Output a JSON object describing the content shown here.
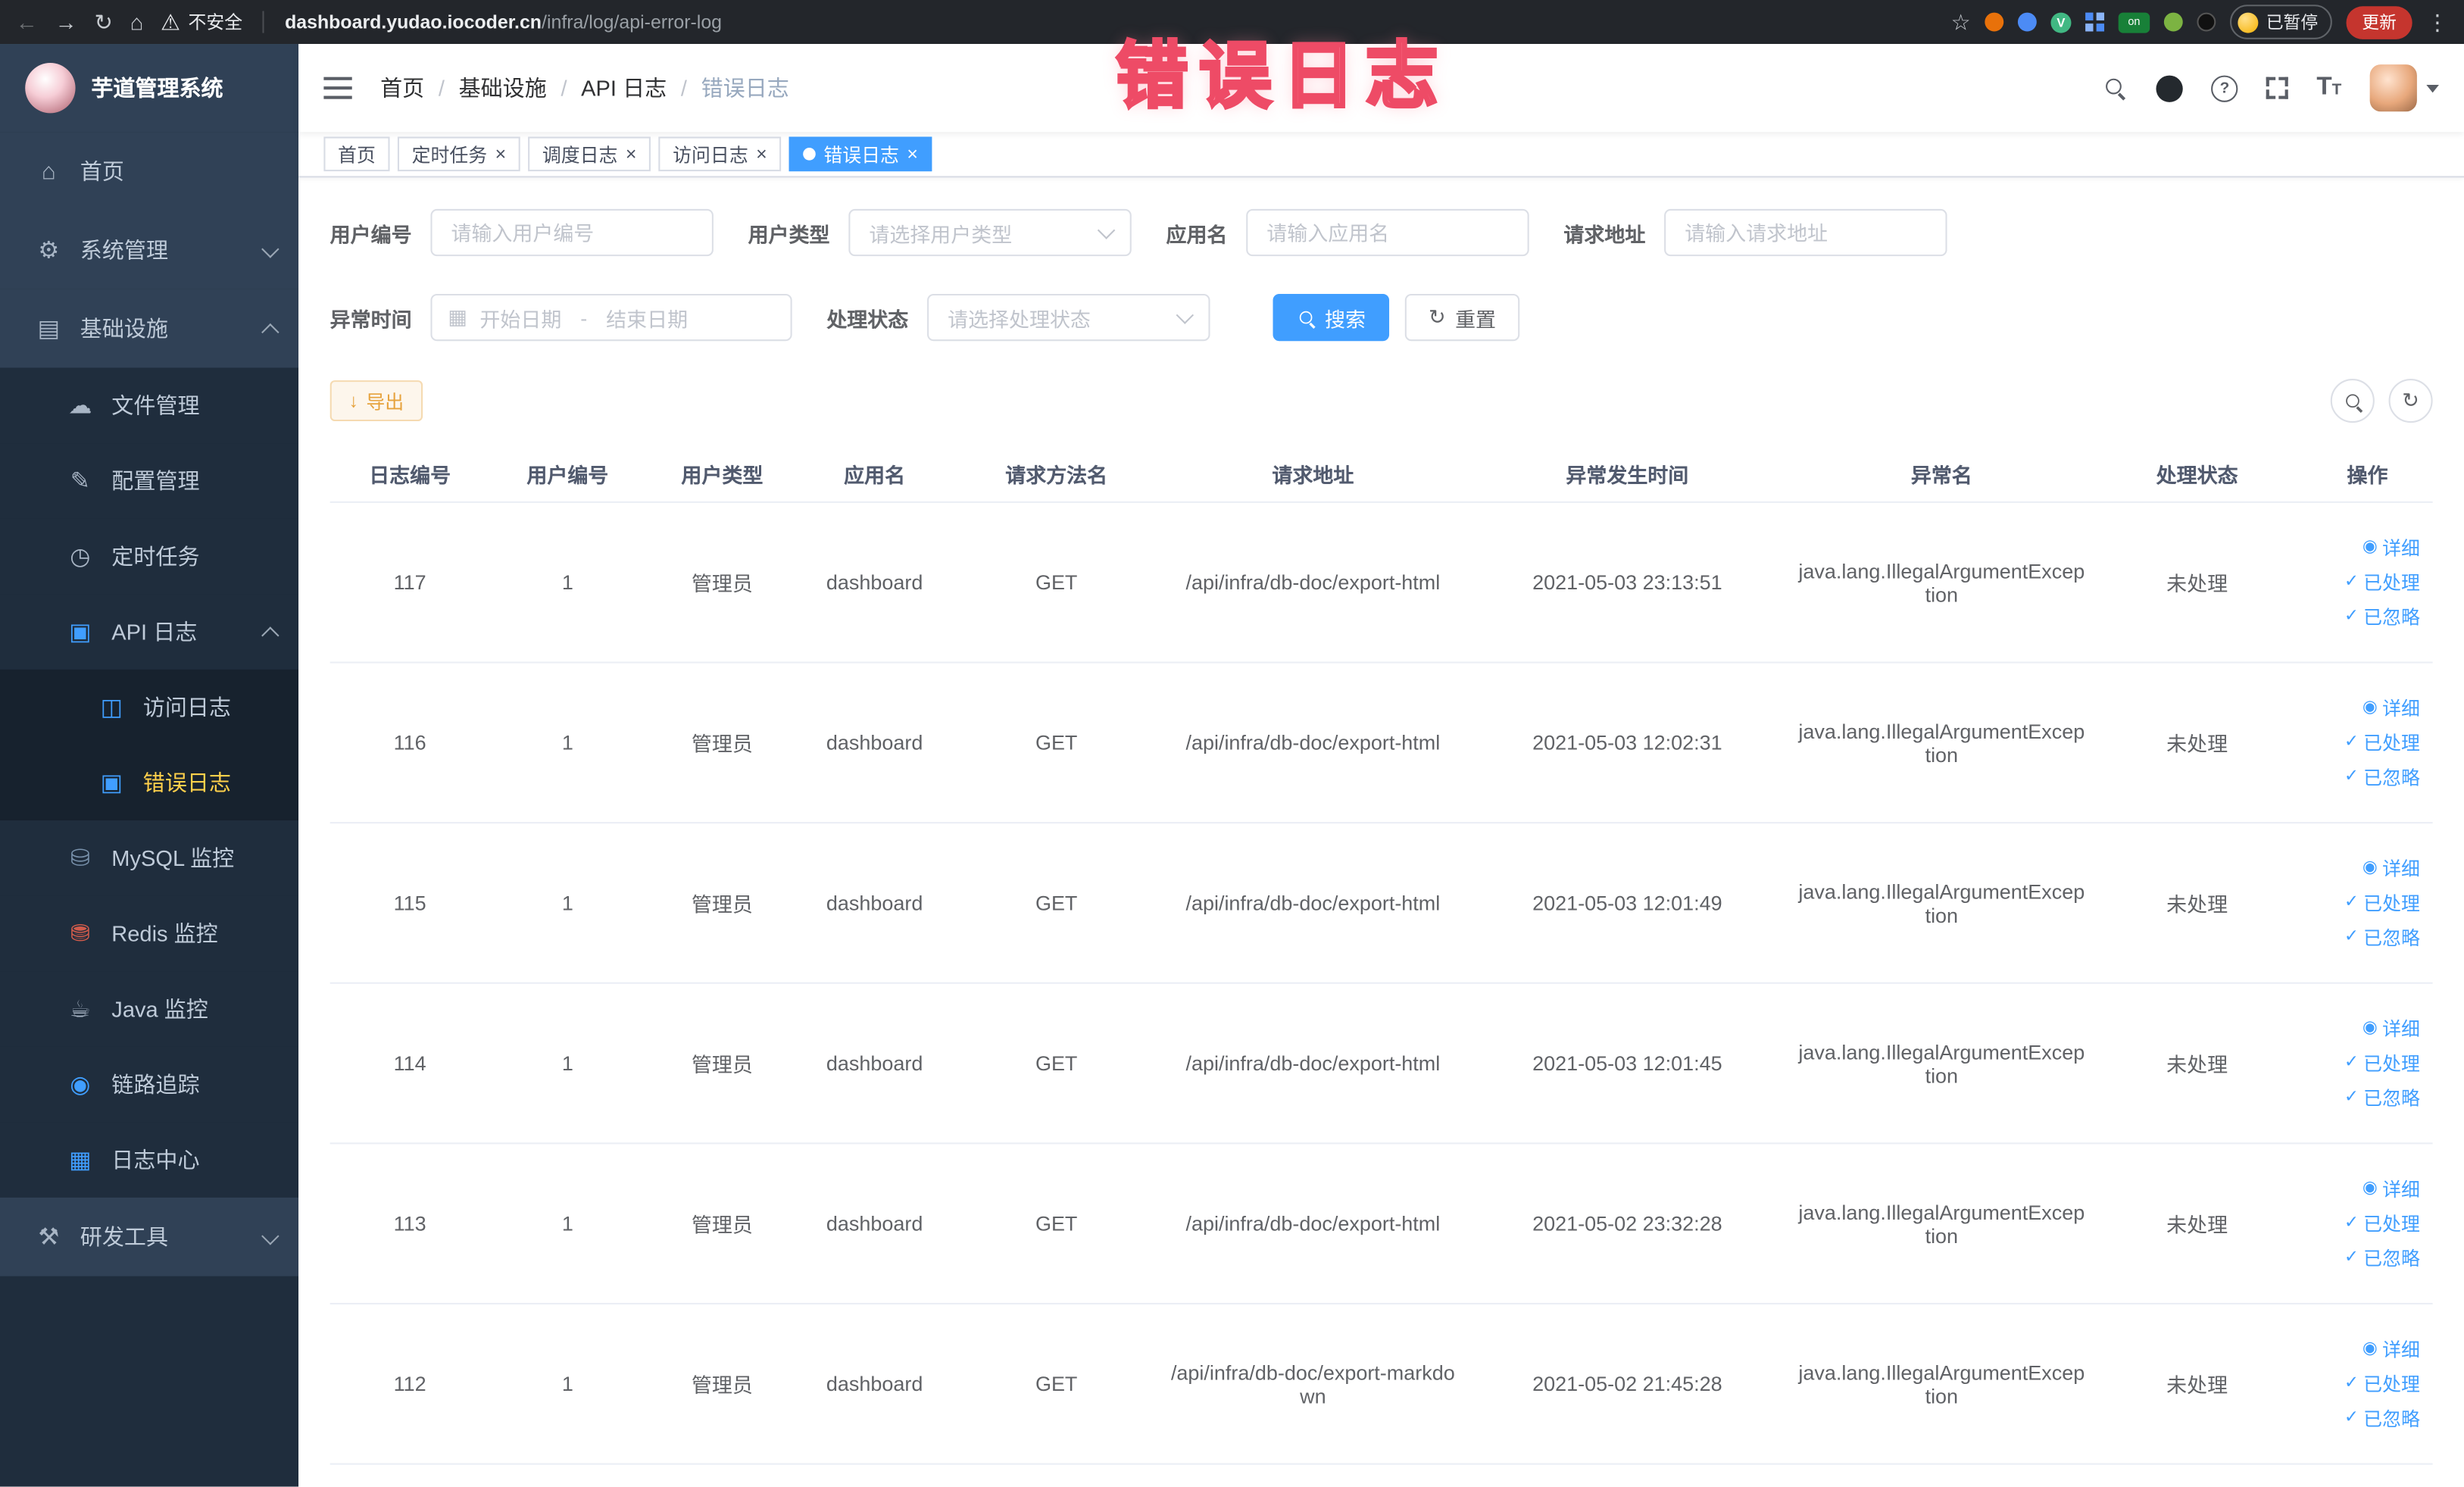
{
  "browser": {
    "security_label": "不安全",
    "url_domain": "dashboard.yudao.iocoder.cn",
    "url_path": "/infra/log/api-error-log",
    "extension_on_label": "on",
    "vue_ext_label": "V",
    "paused_badge": "已暂停",
    "update_button": "更新"
  },
  "watermark": "错误日志",
  "colors": {
    "accent_blue": "#409EFF",
    "sidebar_bg": "#304156",
    "sidebar_submenu_bg": "#1f2d3d",
    "active_menu_text": "#ffd04b",
    "warning_orange": "#e6a23c",
    "watermark_pink": "#ff7d93"
  },
  "sidebar": {
    "logo_title": "芋道管理系统",
    "menu": [
      {
        "label": "首页",
        "icon": "home-icon"
      },
      {
        "label": "系统管理",
        "icon": "system-icon",
        "state": "collapsed"
      },
      {
        "label": "基础设施",
        "icon": "infra-icon",
        "state": "expanded"
      },
      {
        "label": "文件管理",
        "icon": "file-icon"
      },
      {
        "label": "配置管理",
        "icon": "config-icon"
      },
      {
        "label": "定时任务",
        "icon": "job-icon"
      },
      {
        "label": "API 日志",
        "icon": "api-log-icon",
        "state": "expanded"
      },
      {
        "label": "访问日志",
        "icon": "access-log-icon"
      },
      {
        "label": "错误日志",
        "icon": "error-log-icon",
        "active": true
      },
      {
        "label": "MySQL 监控",
        "icon": "mysql-icon"
      },
      {
        "label": "Redis 监控",
        "icon": "redis-icon"
      },
      {
        "label": "Java 监控",
        "icon": "java-icon"
      },
      {
        "label": "链路追踪",
        "icon": "tracing-icon"
      },
      {
        "label": "日志中心",
        "icon": "log-center-icon"
      },
      {
        "label": "研发工具",
        "icon": "dev-tools-icon",
        "state": "collapsed"
      }
    ]
  },
  "navbar": {
    "breadcrumb": [
      "首页",
      "基础设施",
      "API 日志",
      "错误日志"
    ],
    "separator": "/"
  },
  "tabs": [
    {
      "label": "首页",
      "closable": false,
      "active": false
    },
    {
      "label": "定时任务",
      "closable": true,
      "active": false
    },
    {
      "label": "调度日志",
      "closable": true,
      "active": false
    },
    {
      "label": "访问日志",
      "closable": true,
      "active": false
    },
    {
      "label": "错误日志",
      "closable": true,
      "active": true
    }
  ],
  "filters": {
    "user_id": {
      "label": "用户编号",
      "placeholder": "请输入用户编号",
      "value": ""
    },
    "user_type": {
      "label": "用户类型",
      "placeholder": "请选择用户类型"
    },
    "app_name": {
      "label": "应用名",
      "placeholder": "请输入应用名",
      "value": ""
    },
    "request_url": {
      "label": "请求地址",
      "placeholder": "请输入请求地址",
      "value": ""
    },
    "exception_time": {
      "label": "异常时间",
      "start_placeholder": "开始日期",
      "separator": "-",
      "end_placeholder": "结束日期"
    },
    "process_status": {
      "label": "处理状态",
      "placeholder": "请选择处理状态"
    },
    "search_button": "搜索",
    "reset_button": "重置"
  },
  "toolbar": {
    "export_button": "导出"
  },
  "table": {
    "columns": [
      "日志编号",
      "用户编号",
      "用户类型",
      "应用名",
      "请求方法名",
      "请求地址",
      "异常发生时间",
      "异常名",
      "处理状态",
      "操作"
    ],
    "row_actions": [
      {
        "label": "详细",
        "icon": "view-icon"
      },
      {
        "label": "已处理",
        "icon": "check-icon"
      },
      {
        "label": "已忽略",
        "icon": "check-icon"
      }
    ],
    "rows": [
      {
        "id": "117",
        "user_id": "1",
        "user_type": "管理员",
        "app": "dashboard",
        "method": "GET",
        "url": "/api/infra/db-doc/export-html",
        "time": "2021-05-03 23:13:51",
        "exception": "java.lang.IllegalArgumentException",
        "status": "未处理"
      },
      {
        "id": "116",
        "user_id": "1",
        "user_type": "管理员",
        "app": "dashboard",
        "method": "GET",
        "url": "/api/infra/db-doc/export-html",
        "time": "2021-05-03 12:02:31",
        "exception": "java.lang.IllegalArgumentException",
        "status": "未处理"
      },
      {
        "id": "115",
        "user_id": "1",
        "user_type": "管理员",
        "app": "dashboard",
        "method": "GET",
        "url": "/api/infra/db-doc/export-html",
        "time": "2021-05-03 12:01:49",
        "exception": "java.lang.IllegalArgumentException",
        "status": "未处理"
      },
      {
        "id": "114",
        "user_id": "1",
        "user_type": "管理员",
        "app": "dashboard",
        "method": "GET",
        "url": "/api/infra/db-doc/export-html",
        "time": "2021-05-03 12:01:45",
        "exception": "java.lang.IllegalArgumentException",
        "status": "未处理"
      },
      {
        "id": "113",
        "user_id": "1",
        "user_type": "管理员",
        "app": "dashboard",
        "method": "GET",
        "url": "/api/infra/db-doc/export-html",
        "time": "2021-05-02 23:32:28",
        "exception": "java.lang.IllegalArgumentException",
        "status": "未处理"
      },
      {
        "id": "112",
        "user_id": "1",
        "user_type": "管理员",
        "app": "dashboard",
        "method": "GET",
        "url": "/api/infra/db-doc/export-markdown",
        "time": "2021-05-02 21:45:28",
        "exception": "java.lang.IllegalArgumentException",
        "status": "未处理"
      }
    ]
  }
}
